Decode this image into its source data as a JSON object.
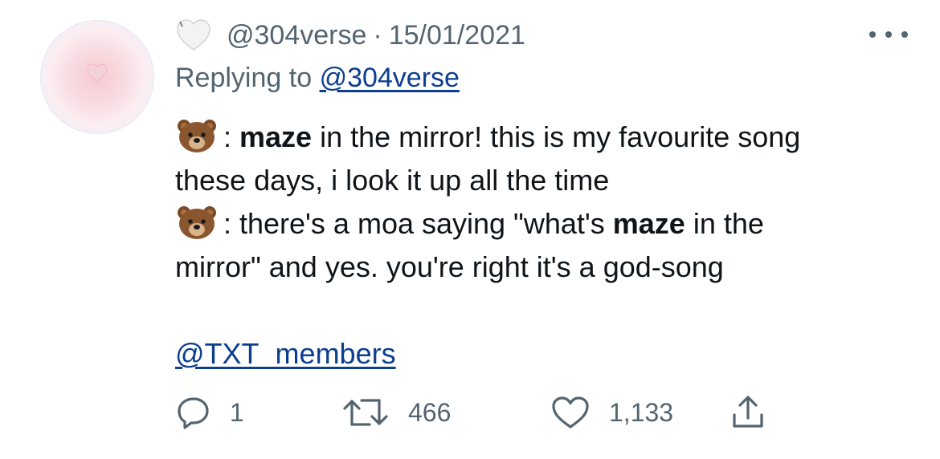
{
  "tweet": {
    "handle": "@304verse",
    "separator": "·",
    "date": "15/01/2021",
    "replying_prefix": "Replying to",
    "replying_handle": "@304verse",
    "lines": [
      {
        "emoji": "bear-face",
        "pre": ": ",
        "bold": "maze",
        "post": " in the mirror! this is my favourite song"
      },
      {
        "text": "these days, i look it up all the time"
      },
      {
        "emoji": "bear-face",
        "pre": ": there's a moa saying \"what's ",
        "bold": "maze",
        "post": " in the"
      },
      {
        "text": "mirror\" and yes. you're right it's a god-song"
      }
    ],
    "mention": "@TXT_members"
  },
  "actions": {
    "reply_count": "1",
    "retweet_count": "466",
    "like_count": "1,133"
  },
  "colors": {
    "text": "#0f1419",
    "muted": "#536471",
    "link": "#0c3e8f"
  },
  "icons": {
    "avatar": "pink-heart-avatar",
    "name": "white-heart-icon",
    "more": "more-dots-icon",
    "emoji": "bear-face-emoji",
    "reply": "reply-icon",
    "retweet": "retweet-icon",
    "like": "heart-icon",
    "share": "share-icon"
  }
}
